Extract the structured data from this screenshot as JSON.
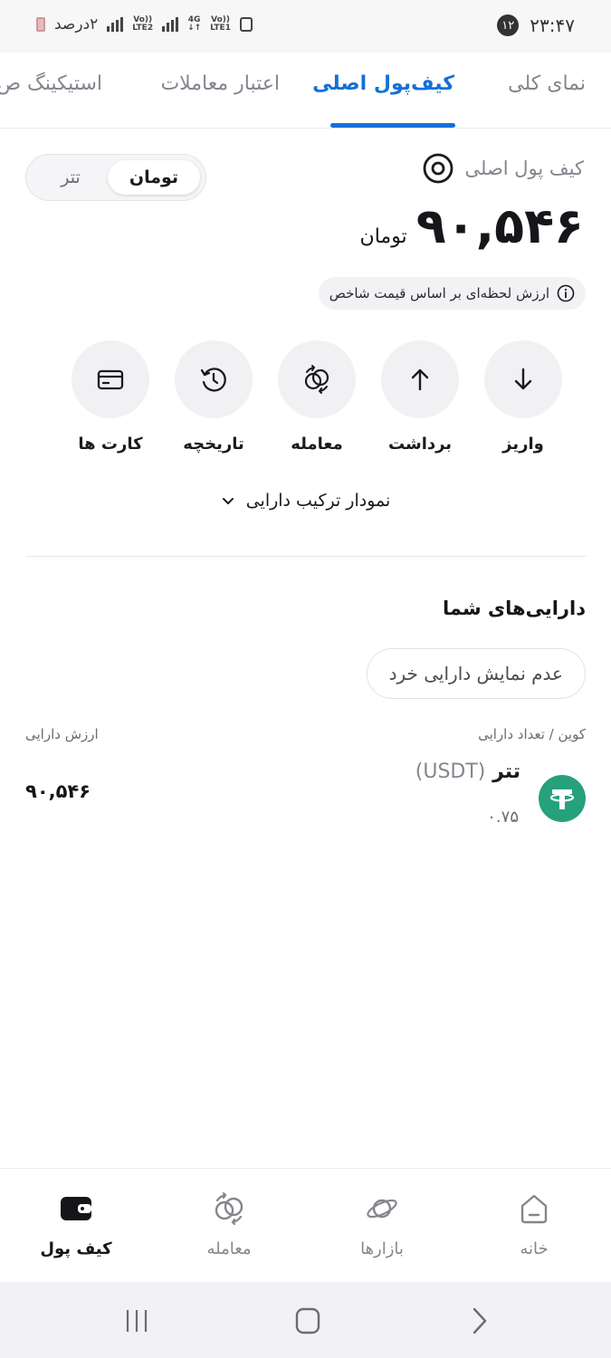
{
  "status_bar": {
    "time": "۲۳:۴۷",
    "notification_count": "۱۲",
    "battery_text": "۲درصد",
    "network_1": "LTE2",
    "network_2": "LTE1",
    "network_type": "4G",
    "volte_label": "Vo))"
  },
  "tabs": [
    {
      "label": "نمای کلی",
      "active": false
    },
    {
      "label": "کیف‌پول اصلی",
      "active": true
    },
    {
      "label": "اعتبار معاملات",
      "active": false
    },
    {
      "label": "استیکینگ ص",
      "active": false
    }
  ],
  "wallet": {
    "title": "کیف پول اصلی",
    "balance": "۹۰,۵۴۶",
    "balance_unit": "تومان",
    "price_note": "ارزش لحظه‌ای بر اساس قیمت شاخص",
    "currency_toggle": {
      "selected": "تومان",
      "other": "تتر"
    }
  },
  "actions": [
    {
      "label": "واریز",
      "icon": "arrow-down-icon"
    },
    {
      "label": "برداشت",
      "icon": "arrow-up-icon"
    },
    {
      "label": "معامله",
      "icon": "exchange-icon"
    },
    {
      "label": "تاریخچه",
      "icon": "history-icon"
    },
    {
      "label": "کارت ها",
      "icon": "card-icon"
    }
  ],
  "chart_toggle": {
    "label": "نمودار ترکیب دارایی"
  },
  "assets": {
    "title": "دارایی‌های شما",
    "hide_small_label": "عدم نمایش دارایی خرد",
    "col_coin": "کوین / تعداد دارایی",
    "col_value": "ارزش دارایی",
    "rows": [
      {
        "name": "تتر",
        "symbol": "(USDT)",
        "quantity": "۰.۷۵",
        "value": "۹۰,۵۴۶",
        "icon": "tether-icon",
        "icon_color": "#26a17b"
      }
    ]
  },
  "bottom_nav": [
    {
      "label": "خانه",
      "icon": "home-icon",
      "active": false
    },
    {
      "label": "بازارها",
      "icon": "planet-icon",
      "active": false
    },
    {
      "label": "معامله",
      "icon": "exchange-icon",
      "active": false
    },
    {
      "label": "کیف پول",
      "icon": "wallet-icon",
      "active": true
    }
  ],
  "colors": {
    "accent": "#1570d6",
    "tether": "#26a17b"
  }
}
